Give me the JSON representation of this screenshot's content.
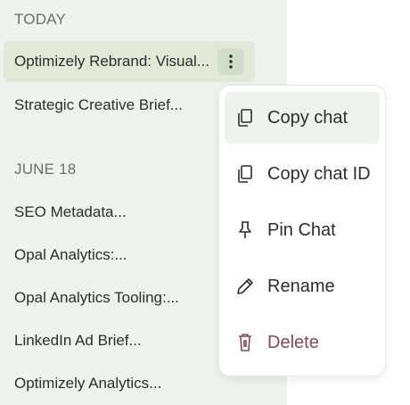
{
  "sidebar": {
    "sections": [
      {
        "label": "TODAY",
        "items": [
          "Optimizely Rebrand: Visual...",
          "Strategic Creative Brief..."
        ]
      },
      {
        "label": "JUNE 18",
        "items": [
          "SEO Metadata...",
          "Opal Analytics:...",
          "Opal Analytics Tooling:...",
          "LinkedIn Ad Brief...",
          "Optimizely Analytics..."
        ]
      }
    ]
  },
  "context_menu": {
    "items": [
      {
        "label": "Copy chat",
        "icon": "copy-icon"
      },
      {
        "label": "Copy chat ID",
        "icon": "copy-icon"
      },
      {
        "label": "Pin Chat",
        "icon": "pin-icon"
      },
      {
        "label": "Rename",
        "icon": "pencil-icon"
      },
      {
        "label": "Delete",
        "icon": "trash-icon"
      }
    ]
  },
  "colors": {
    "sidebar_bg": "#eef3ed",
    "active_item_bg": "#e1ead9",
    "danger": "#7d4a5e"
  }
}
